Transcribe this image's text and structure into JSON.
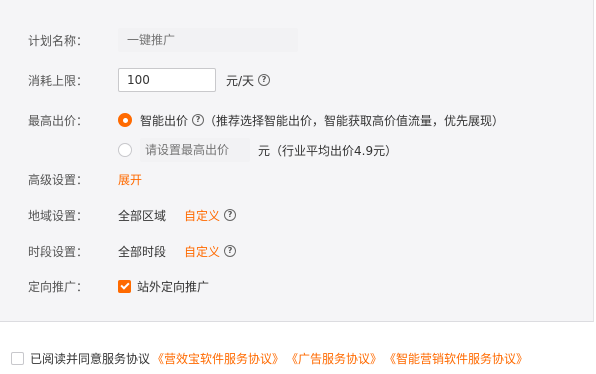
{
  "form": {
    "plan_name": {
      "label": "计划名称：",
      "placeholder": "一键推广",
      "value": ""
    },
    "budget": {
      "label": "消耗上限：",
      "value": "100",
      "unit": "元/天"
    },
    "max_bid": {
      "label": "最高出价：",
      "smart_option": {
        "label": "智能出价",
        "note": "（推荐选择智能出价，智能获取高价值流量，优先展现）"
      },
      "manual_option": {
        "placeholder": "请设置最高出价",
        "unit": "元",
        "note": "（行业平均出价4.9元）"
      }
    },
    "advanced": {
      "label": "高级设置：",
      "link": "展开"
    },
    "region": {
      "label": "地域设置：",
      "value": "全部区域",
      "link": "自定义"
    },
    "schedule": {
      "label": "时段设置：",
      "value": "全部时段",
      "link": "自定义"
    },
    "targeting": {
      "label": "定向推广：",
      "checkbox_label": "站外定向推广"
    }
  },
  "agreement": {
    "text": "已阅读并同意服务协议",
    "links": [
      "《营效宝软件服务协议》",
      "《广告服务协议》",
      "《智能营销软件服务协议》"
    ]
  },
  "colors": {
    "accent": "#ff6a00",
    "panel_bg": "#f5f5f7"
  },
  "icons": {
    "help": "question-circle-icon"
  }
}
